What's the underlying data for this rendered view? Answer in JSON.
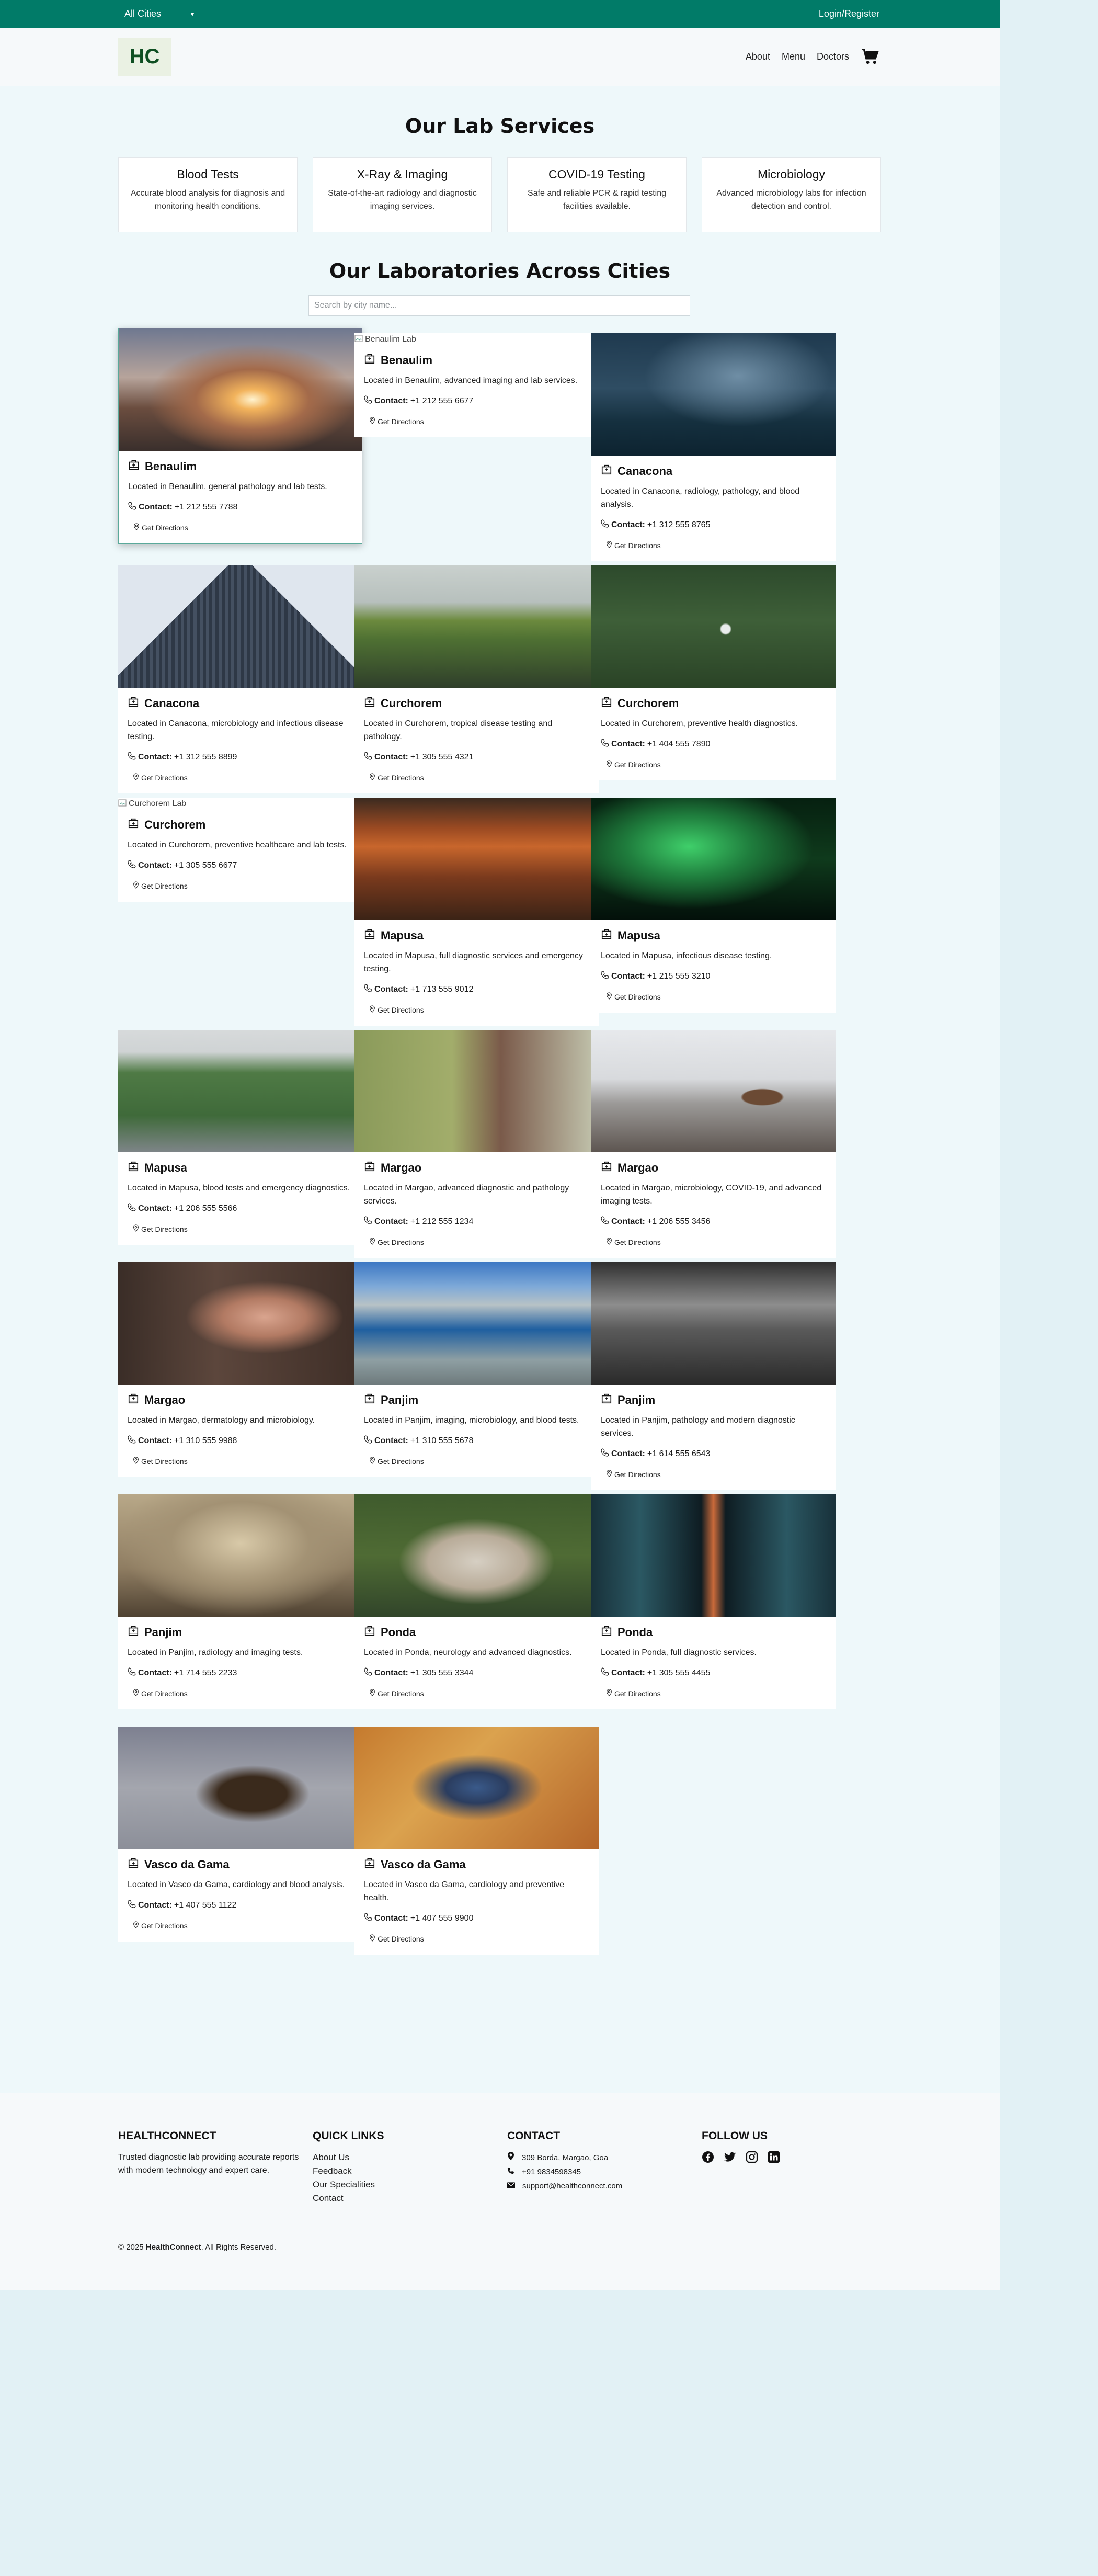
{
  "topbar": {
    "city_select": "All Cities",
    "login": "Login/Register"
  },
  "header": {
    "logo": "HC",
    "nav": [
      "About",
      "Menu",
      "Doctors"
    ]
  },
  "services": {
    "title": "Our Lab Services",
    "items": [
      {
        "name": "Blood Tests",
        "desc": "Accurate blood analysis for diagnosis and monitoring health conditions."
      },
      {
        "name": "X-Ray & Imaging",
        "desc": "State-of-the-art radiology and diagnostic imaging services."
      },
      {
        "name": "COVID-19 Testing",
        "desc": "Safe and reliable PCR & rapid testing facilities available."
      },
      {
        "name": "Microbiology",
        "desc": "Advanced microbiology labs for infection detection and control."
      }
    ]
  },
  "labs": {
    "title": "Our Laboratories Across Cities",
    "search_placeholder": "Search by city name...",
    "contact_label": "Contact:",
    "directions_label": "Get Directions",
    "cards": [
      {
        "city": "Benaulim",
        "desc": "Located in Benaulim, general pathology and lab tests.",
        "phone": "+1 212 555 7788",
        "image": "sunset-railway-yard"
      },
      {
        "city": "Benaulim",
        "desc": "Located in Benaulim, advanced imaging and lab services.",
        "phone": "+1 212 555 6677",
        "broken_alt": "Benaulim Lab"
      },
      {
        "city": "Canacona",
        "desc": "Located in Canacona, radiology, pathology, and blood analysis.",
        "phone": "+1 312 555 8765",
        "image": "stormy-sea"
      },
      {
        "city": "Canacona",
        "desc": "Located in Canacona, microbiology and infectious disease testing.",
        "phone": "+1 312 555 8899",
        "image": "glass-skyscraper"
      },
      {
        "city": "Curchorem",
        "desc": "Located in Curchorem, tropical disease testing and pathology.",
        "phone": "+1 305 555 4321",
        "image": "green-cliffs"
      },
      {
        "city": "Curchorem",
        "desc": "Located in Curchorem, preventive health diagnostics.",
        "phone": "+1 404 555 7890",
        "image": "forest-cyclist"
      },
      {
        "city": "Curchorem",
        "desc": "Located in Curchorem, preventive healthcare and lab tests.",
        "phone": "+1 305 555 6677",
        "broken_alt": "Curchorem Lab"
      },
      {
        "city": "Mapusa",
        "desc": "Located in Mapusa, full diagnostic services and emergency testing.",
        "phone": "+1 713 555 9012",
        "image": "red-canyon"
      },
      {
        "city": "Mapusa",
        "desc": "Located in Mapusa, infectious disease testing.",
        "phone": "+1 215 555 3210",
        "image": "aurora-night"
      },
      {
        "city": "Mapusa",
        "desc": "Located in Mapusa, blood tests and emergency diagnostics.",
        "phone": "+1 206 555 5566",
        "image": "city-park"
      },
      {
        "city": "Margao",
        "desc": "Located in Margao, advanced diagnostic and pathology services.",
        "phone": "+1 212 555 1234",
        "image": "person-with-dog"
      },
      {
        "city": "Margao",
        "desc": "Located in Margao, microbiology, COVID-19, and advanced imaging tests.",
        "phone": "+1 206 555 3456",
        "image": "bear-winter"
      },
      {
        "city": "Margao",
        "desc": "Located in Margao, dermatology and microbiology.",
        "phone": "+1 310 555 9988",
        "image": "woman-portrait"
      },
      {
        "city": "Panjim",
        "desc": "Located in Panjim, imaging, microbiology, and blood tests.",
        "phone": "+1 310 555 5678",
        "image": "fjord-blue"
      },
      {
        "city": "Panjim",
        "desc": "Located in Panjim, pathology and modern diagnostic services.",
        "phone": "+1 614 555 6543",
        "image": "misty-forest-bw"
      },
      {
        "city": "Panjim",
        "desc": "Located in Panjim, radiology and imaging tests.",
        "phone": "+1 714 555 2233",
        "image": "dead-trees-fog"
      },
      {
        "city": "Ponda",
        "desc": "Located in Ponda, neurology and advanced diagnostics.",
        "phone": "+1 305 555 3344",
        "image": "pug-blanket"
      },
      {
        "city": "Ponda",
        "desc": "Located in Ponda, full diagnostic services.",
        "phone": "+1 305 555 4455",
        "image": "escalator-station"
      },
      {
        "city": "Vasco da Gama",
        "desc": "Located in Vasco da Gama, cardiology and blood analysis.",
        "phone": "+1 407 555 1122",
        "image": "vulture-flight"
      },
      {
        "city": "Vasco da Gama",
        "desc": "Located in Vasco da Gama, cardiology and preventive health.",
        "phone": "+1 407 555 9900",
        "image": "orange-texture"
      }
    ]
  },
  "footer": {
    "brand_heading": "HEALTHCONNECT",
    "about": "Trusted diagnostic lab providing accurate reports with modern technology and expert care.",
    "links_heading": "QUICK LINKS",
    "links": [
      "About Us",
      "Feedback",
      "Our Specialities",
      "Contact"
    ],
    "contact_heading": "CONTACT",
    "address": "309 Borda, Margao, Goa",
    "phone": "+91 9834598345",
    "email": "support@healthconnect.com",
    "follow_heading": "FOLLOW US",
    "social": [
      "facebook-icon",
      "twitter-icon",
      "instagram-icon",
      "linkedin-icon"
    ],
    "copy_prefix": "© 2025 ",
    "copy_brand": "HealthConnect",
    "copy_suffix": ". All Rights Reserved."
  },
  "colors": {
    "topbar": "#017b68",
    "page_bg": "#eef8fa",
    "outer_bg": "#e2f1f5",
    "logo_bg": "#eaf1e3",
    "logo_text": "#0f4f22"
  }
}
